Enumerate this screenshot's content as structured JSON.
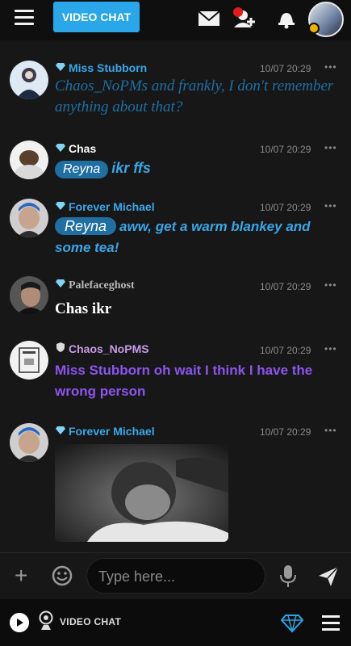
{
  "header": {
    "video_chat_label": "VIDEO CHAT"
  },
  "messages": [
    {
      "name": "Miss Stubborn",
      "name_color": "#3aa7e8",
      "time": "10/07 20:29",
      "rank_icon": "diamond-icon",
      "mention": "",
      "text": "Chaos_NoPMs and frankly, I don't remember anything about that?",
      "text_color": "#1f6fa3"
    },
    {
      "name": "Chas",
      "name_color": "#ffffff",
      "time": "10/07 20:29",
      "rank_icon": "diamond-icon",
      "mention": "Reyna",
      "text": "ikr ffs",
      "text_color": "#3aa7e8"
    },
    {
      "name": "Forever Michael",
      "name_color": "#3aa7e8",
      "time": "10/07 20:29",
      "rank_icon": "diamond-icon",
      "mention": "Reyna",
      "text": "aww, get a warm blankey and some tea!",
      "text_color": "#3aa7e8"
    },
    {
      "name": "Palefaceghost",
      "name_color": "#b8b8b8",
      "time": "10/07 20:29",
      "rank_icon": "diamond-icon",
      "mention": "",
      "text": "Chas ikr",
      "text_color": "#ffffff"
    },
    {
      "name": "Chaos_NoPMS",
      "name_color": "#c99be8",
      "time": "10/07 20:29",
      "rank_icon": "shield-icon",
      "mention": "",
      "text": "Miss Stubborn oh wait I think I have the wrong person",
      "text_color": "#8c55f0"
    },
    {
      "name": "Forever Michael",
      "name_color": "#3aa7e8",
      "time": "10/07 20:29",
      "rank_icon": "diamond-icon",
      "mention": "",
      "text": "",
      "text_color": "#3aa7e8",
      "image": "photo-attachment"
    }
  ],
  "composer": {
    "placeholder": "Type here..."
  },
  "footer": {
    "video_chat_label": "VIDEO CHAT"
  },
  "colors": {
    "accent": "#2aa7e8",
    "notification": "#e01c1c",
    "status_away": "#f0b400"
  }
}
